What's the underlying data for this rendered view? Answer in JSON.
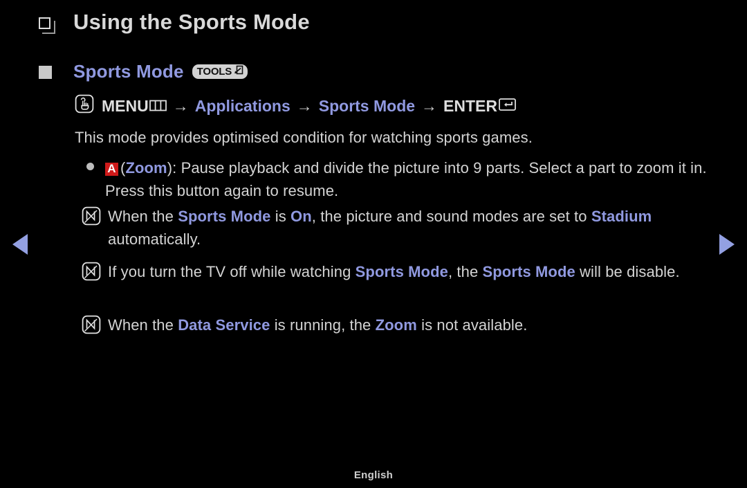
{
  "page": {
    "title": "Using the Sports Mode",
    "footer_language": "English",
    "background_color": "#000000",
    "accent_color": "#9099e0",
    "text_color": "#d4d4d4",
    "badge_red": "#cf1a1a"
  },
  "section": {
    "heading": "Sports Mode",
    "tools_badge_label": "TOOLS",
    "tools_badge_icon": "enter-box-icon"
  },
  "nav_path": {
    "menu_icon": "hand-press-icon",
    "menu_label": "MENU",
    "menu_label_icon": "menu-bars-icon",
    "separator": "→",
    "step_applications": "Applications",
    "step_sports_mode": "Sports Mode",
    "enter_label": "ENTER",
    "enter_icon": "enter-return-icon"
  },
  "description": "This mode provides optimised condition for watching sports games.",
  "items": [
    {
      "marker": "dot",
      "badge": "A",
      "segments": [
        {
          "text": "(",
          "style": "plain"
        },
        {
          "text": "Zoom",
          "style": "bold-blue"
        },
        {
          "text": "): Pause playback and divide the picture into 9 parts. Select a part to zoom it in. Press this button again to resume.",
          "style": "plain"
        }
      ]
    },
    {
      "marker": "note",
      "segments": [
        {
          "text": "When the ",
          "style": "plain"
        },
        {
          "text": "Sports Mode",
          "style": "bold-blue"
        },
        {
          "text": " is ",
          "style": "plain"
        },
        {
          "text": "On",
          "style": "bold-blue"
        },
        {
          "text": ", the picture and sound modes are set to ",
          "style": "plain"
        },
        {
          "text": "Stadium",
          "style": "bold-blue"
        },
        {
          "text": " automatically.",
          "style": "plain"
        }
      ]
    },
    {
      "marker": "note",
      "segments": [
        {
          "text": "If you turn the TV off while watching ",
          "style": "plain"
        },
        {
          "text": "Sports Mode",
          "style": "bold-blue"
        },
        {
          "text": ", the ",
          "style": "plain"
        },
        {
          "text": "Sports Mode",
          "style": "bold-blue"
        },
        {
          "text": " will be disable.",
          "style": "plain"
        }
      ]
    },
    {
      "marker": "note",
      "segments": [
        {
          "text": "When the ",
          "style": "plain"
        },
        {
          "text": "Data Service",
          "style": "bold-blue"
        },
        {
          "text": " is running, the ",
          "style": "plain"
        },
        {
          "text": "Zoom",
          "style": "bold-blue"
        },
        {
          "text": " is not available.",
          "style": "plain"
        }
      ]
    }
  ],
  "navigation": {
    "prev_icon": "triangle-left-icon",
    "next_icon": "triangle-right-icon"
  }
}
